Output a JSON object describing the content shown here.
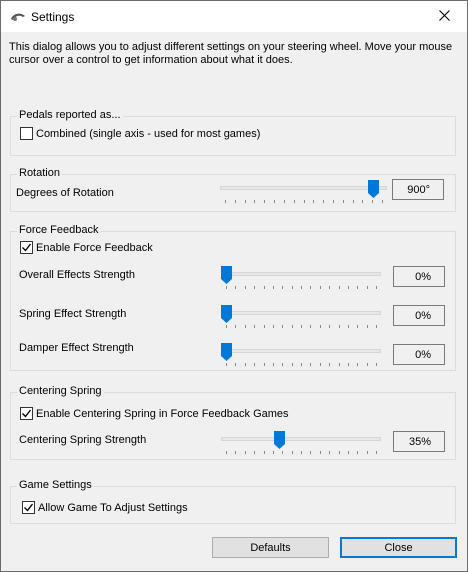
{
  "window": {
    "title": "Settings",
    "description": "This dialog allows you to adjust different settings on your steering wheel.  Move your mouse cursor over a control to get information about what it does."
  },
  "pedals": {
    "group_title": "Pedals reported as...",
    "combined_label": "Combined (single axis - used for most games)",
    "combined_checked": false
  },
  "rotation": {
    "group_title": "Rotation",
    "degrees_label": "Degrees of Rotation",
    "degrees_value": "900°",
    "degrees_level": 0.94
  },
  "force_feedback": {
    "group_title": "Force Feedback",
    "enable_label": "Enable Force Feedback",
    "enable_checked": true,
    "overall_label": "Overall Effects Strength",
    "overall_value": "0%",
    "overall_level": 0.0,
    "spring_label": "Spring Effect Strength",
    "spring_value": "0%",
    "spring_level": 0.0,
    "damper_label": "Damper Effect Strength",
    "damper_value": "0%",
    "damper_level": 0.0
  },
  "centering": {
    "group_title": "Centering Spring",
    "enable_label": "Enable Centering Spring in Force Feedback Games",
    "enable_checked": true,
    "strength_label": "Centering Spring Strength",
    "strength_value": "35%",
    "strength_level": 0.35
  },
  "game": {
    "group_title": "Game Settings",
    "allow_label": "Allow Game To Adjust Settings",
    "allow_checked": true
  },
  "buttons": {
    "defaults_label": "Defaults",
    "close_label": "Close"
  },
  "colors": {
    "accent": "#0078d7"
  }
}
